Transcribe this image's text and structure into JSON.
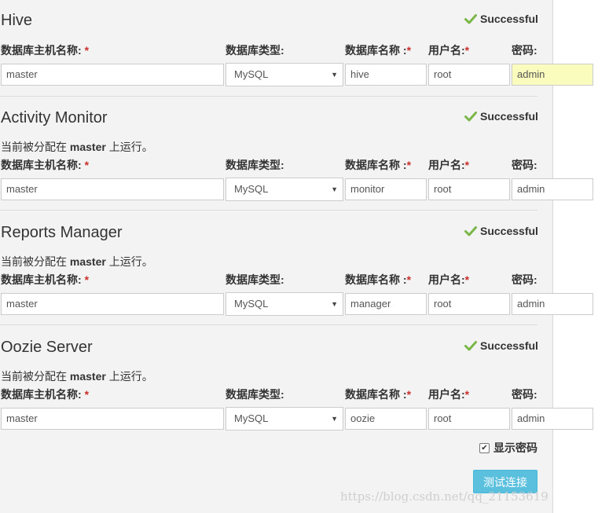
{
  "form": {
    "labels": {
      "host": "数据库主机名称:",
      "type": "数据库类型:",
      "dbname": "数据库名称 :",
      "user": "用户名:",
      "password": "密码:",
      "required": "*"
    },
    "assigned": {
      "prefix": "当前被分配在",
      "host": "master",
      "suffix": "上运行。"
    },
    "sections": [
      {
        "title": "Hive",
        "status": "Successful",
        "host": "master",
        "db_type": "MySQL",
        "db_name": "hive",
        "user": "root",
        "password": "admin"
      },
      {
        "title": "Activity Monitor",
        "status": "Successful",
        "host": "master",
        "db_type": "MySQL",
        "db_name": "monitor",
        "user": "root",
        "password": "admin"
      },
      {
        "title": "Reports Manager",
        "status": "Successful",
        "host": "master",
        "db_type": "MySQL",
        "db_name": "manager",
        "user": "root",
        "password": "admin"
      },
      {
        "title": "Oozie Server",
        "status": "Successful",
        "host": "master",
        "db_type": "MySQL",
        "db_name": "oozie",
        "user": "root",
        "password": "admin"
      }
    ],
    "show_password_label": "显示密码",
    "show_password_checked": true,
    "test_button_label": "测试连接"
  },
  "colors": {
    "success_check": "#7ab648",
    "button": "#5bc0de",
    "required": "#c9302c",
    "focused_field": "#fafcbd"
  },
  "watermark": "https://blog.csdn.net/qq_21153619"
}
